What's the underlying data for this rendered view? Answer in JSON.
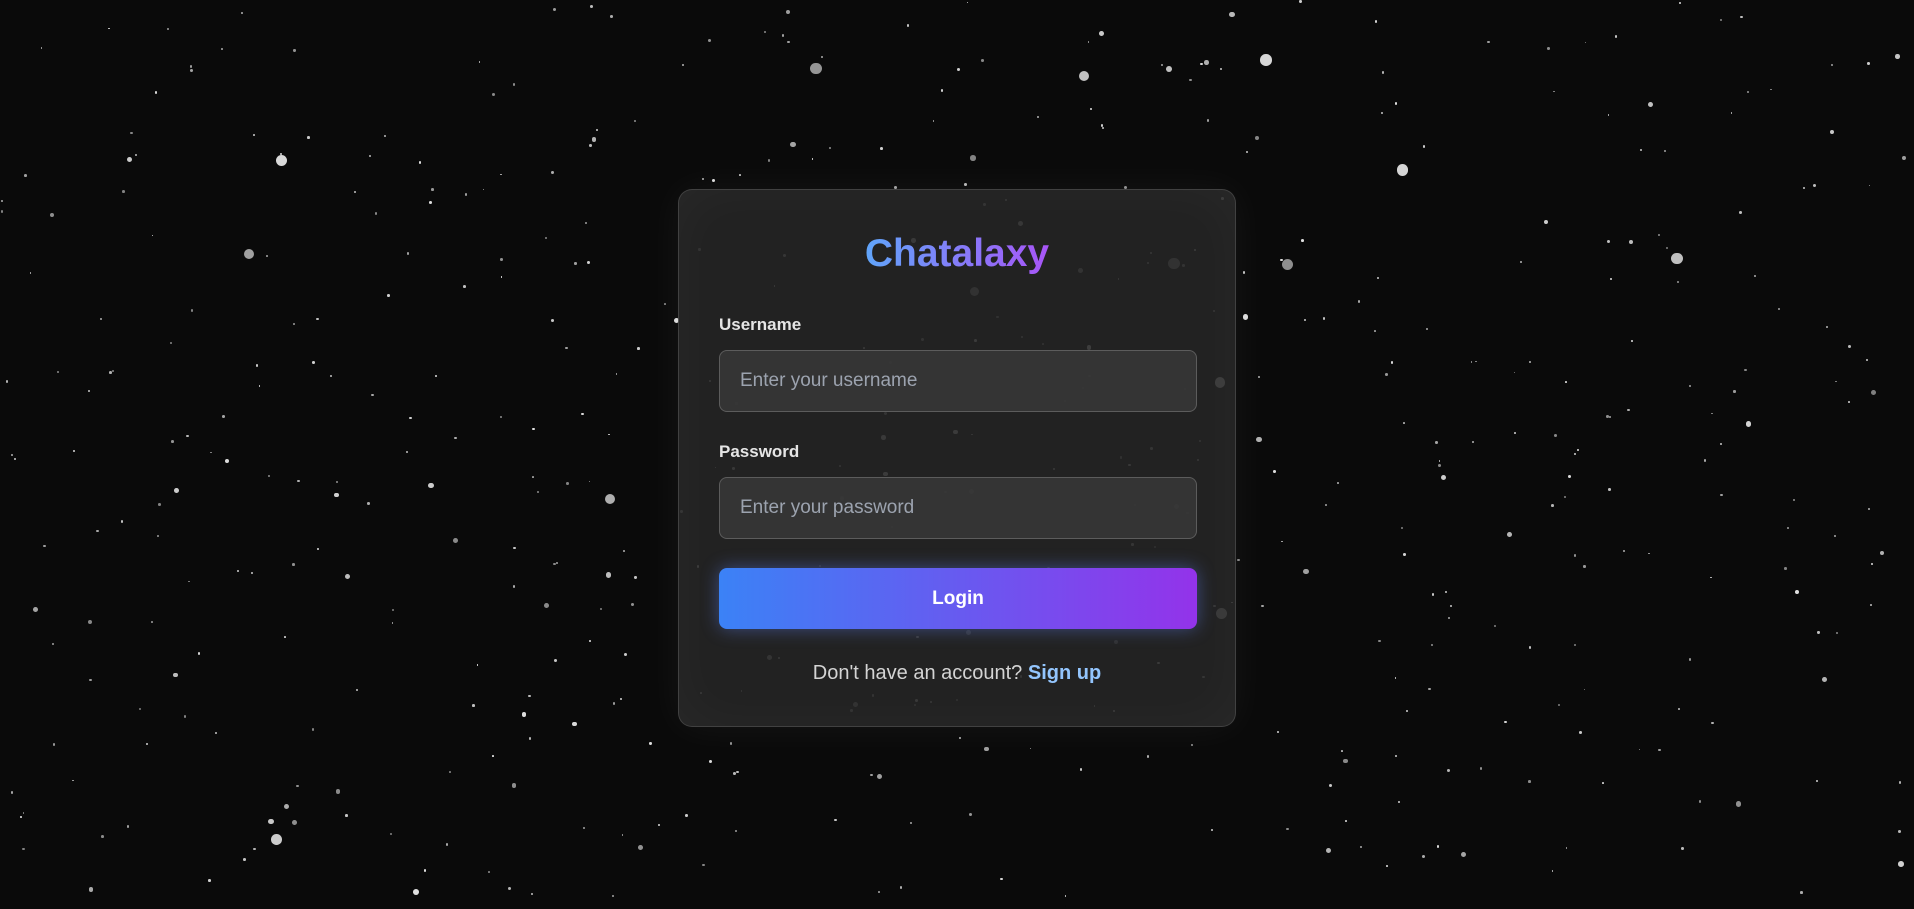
{
  "app": {
    "brand": "Chatalaxy"
  },
  "form": {
    "username_label": "Username",
    "username_placeholder": "Enter your username",
    "password_label": "Password",
    "password_placeholder": "Enter your password",
    "login_label": "Login",
    "signup_prompt": "Don't have an account?",
    "signup_link": "Sign up"
  },
  "colors": {
    "background": "#0a0a0a",
    "gradient_start": "#3b82f6",
    "gradient_end": "#9333ea",
    "link": "#93c5fd"
  }
}
